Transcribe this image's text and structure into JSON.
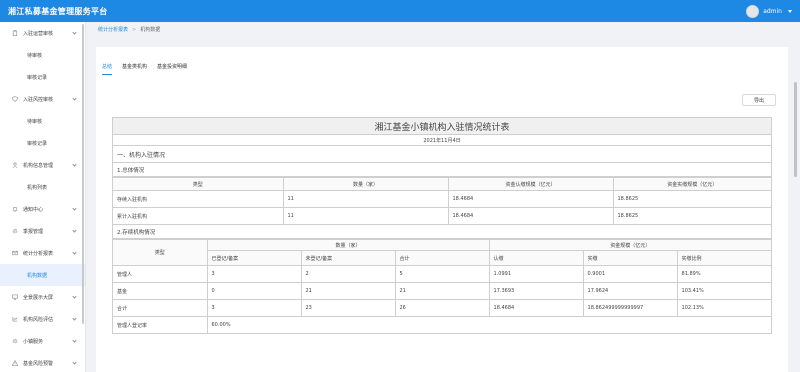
{
  "app": {
    "title": "湘江私募基金管理服务平台",
    "user": "admin"
  },
  "sidebar": {
    "items": [
      {
        "label": "入驻运营审核",
        "type": "group",
        "icon": "clipboard-icon"
      },
      {
        "label": "待审核",
        "type": "sub"
      },
      {
        "label": "审核记录",
        "type": "sub"
      },
      {
        "label": "入驻风控审核",
        "type": "group",
        "icon": "shield-icon"
      },
      {
        "label": "待审核",
        "type": "sub"
      },
      {
        "label": "审核记录",
        "type": "sub"
      },
      {
        "label": "机构信息管理",
        "type": "group",
        "icon": "person-icon"
      },
      {
        "label": "机构列表",
        "type": "sub"
      },
      {
        "label": "通知中心",
        "type": "group",
        "icon": "bell-icon"
      },
      {
        "label": "季报管理",
        "type": "group",
        "icon": "gear-icon"
      },
      {
        "label": "统计分析报表",
        "type": "group",
        "icon": "mail-icon"
      },
      {
        "label": "机构数据",
        "type": "sub",
        "active": true
      },
      {
        "label": "全景展示大屏",
        "type": "group",
        "icon": "monitor-icon"
      },
      {
        "label": "机构风险评估",
        "type": "group",
        "icon": "chart-icon"
      },
      {
        "label": "小镇服务",
        "type": "group",
        "icon": "gear-icon"
      },
      {
        "label": "基金风险预警",
        "type": "group",
        "icon": "warning-icon"
      }
    ]
  },
  "breadcrumb": [
    "统计分析报表",
    "机构数据"
  ],
  "tabs": [
    "总结",
    "基金类机构",
    "基金投资明细"
  ],
  "export_label": "导出",
  "report": {
    "title": "湘江基金小镇机构入驻情况统计表",
    "date": "2021年11月4日",
    "section1": "一、机构入驻情况",
    "sub1": "1.总体情况",
    "table1": {
      "headers": [
        "类型",
        "数量（家）",
        "资金认缴规模（亿元）",
        "资金实缴规模（亿元）"
      ],
      "rows": [
        [
          "存续入驻机构",
          "11",
          "18.4684",
          "18.8625"
        ],
        [
          "累计入驻机构",
          "11",
          "18.4684",
          "18.8625"
        ]
      ]
    },
    "sub2": "2.存续机构情况",
    "table2": {
      "type_header": "类型",
      "group_count": "数量（家）",
      "group_fund": "资金规模（亿元）",
      "sub_headers": [
        "已登记/备案",
        "未登记/备案",
        "合计",
        "认缴",
        "实缴",
        "实缴比例"
      ],
      "rows": [
        [
          "管理人",
          "3",
          "2",
          "5",
          "1.0991",
          "0.9001",
          "81.89%"
        ],
        [
          "基金",
          "0",
          "21",
          "21",
          "17.3693",
          "17.9624",
          "103.41%"
        ],
        [
          "合计",
          "3",
          "23",
          "26",
          "18.4684",
          "18.862499999999997",
          "102.13%"
        ]
      ],
      "reg_rate_label": "管理人登记率",
      "reg_rate_value": "60.00%"
    }
  }
}
